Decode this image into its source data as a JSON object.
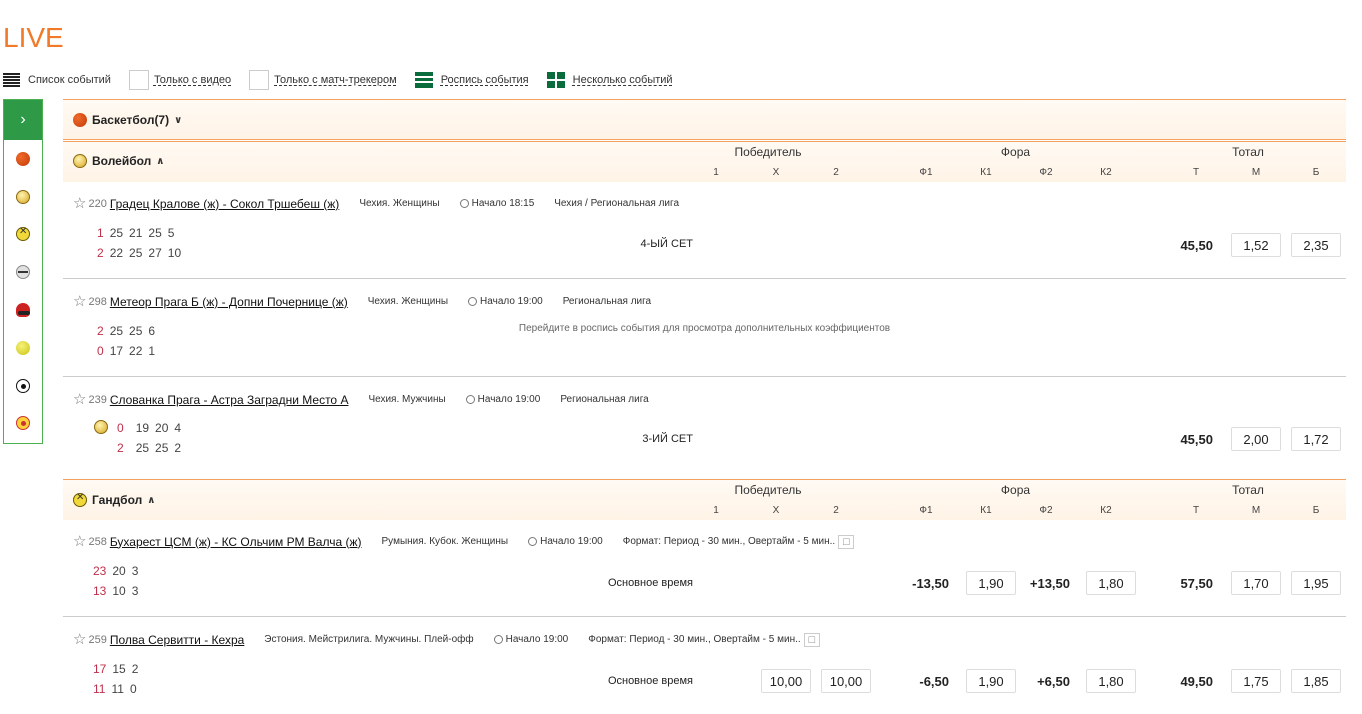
{
  "page_title": "LIVE",
  "viewbar": {
    "event_list": "Список событий",
    "only_video": "Только с видео",
    "only_tracker": "Только с матч-трекером",
    "event_detail": "Роспись события",
    "multi_events": "Несколько событий"
  },
  "sidebar": {
    "toggle_icon": "chevron-right-icon",
    "sports_icons": [
      "basketball-icon",
      "volleyball-icon",
      "handball-icon",
      "hockey-icon",
      "baseball-icon",
      "tennis-icon",
      "football-icon",
      "futsal-icon"
    ]
  },
  "market_headers": {
    "winner": "Победитель",
    "handicap": "Фора",
    "total": "Тотал",
    "c1": "1",
    "cx": "X",
    "c2": "2",
    "f1": "Ф1",
    "k1": "К1",
    "f2": "Ф2",
    "k2": "К2",
    "t": "Т",
    "m": "М",
    "b": "Б"
  },
  "basketball": {
    "name": "Баскетбол(7)"
  },
  "volleyball": {
    "name": "Волейбол",
    "events": [
      {
        "num": "220",
        "match": "Градец Кралове (ж) - Сокол Тршебеш (ж)",
        "country": "Чехия. Женщины",
        "start": "Начало 18:15",
        "league": "Чехия / Региональная лига",
        "top": {
          "sets": "1",
          "games": [
            "25",
            "21",
            "25",
            "5"
          ]
        },
        "bottom": {
          "sets": "2",
          "games": [
            "22",
            "25",
            "27",
            "10"
          ]
        },
        "period": "4-ЫЙ СЕТ",
        "total": "45,50",
        "under": "1,52",
        "over": "2,35"
      },
      {
        "num": "298",
        "match": "Метеор Прага Б (ж) - Допни Почернице (ж)",
        "country": "Чехия. Женщины",
        "start": "Начало 19:00",
        "league": "Региональная лига",
        "top": {
          "sets": "2",
          "games": [
            "25",
            "25",
            "6"
          ]
        },
        "bottom": {
          "sets": "0",
          "games": [
            "17",
            "22",
            "1"
          ]
        },
        "note": "Перейдите в роспись события для просмотра дополнительных коэффициентов"
      },
      {
        "num": "239",
        "match": "Слованка Прага - Астра Заградни Место А",
        "country": "Чехия. Мужчины",
        "start": "Начало 19:00",
        "league": "Региональная лига",
        "top": {
          "sets": "0",
          "games": [
            "19",
            "20",
            "4"
          ]
        },
        "bottom": {
          "sets": "2",
          "games": [
            "25",
            "25",
            "2"
          ]
        },
        "period": "3-ИЙ СЕТ",
        "total": "45,50",
        "under": "2,00",
        "over": "1,72"
      }
    ]
  },
  "handball": {
    "name": "Гандбол",
    "events": [
      {
        "num": "258",
        "match": "Бухарест ЦСМ (ж) - КС Ольчим РМ Валча (ж)",
        "country": "Румыния. Кубок. Женщины",
        "start": "Начало 19:00",
        "league": "Формат: Период - 30 мин., Овертайм - 5 мин..",
        "top": {
          "sets": "23",
          "games": [
            "20",
            "3"
          ]
        },
        "bottom": {
          "sets": "13",
          "games": [
            "10",
            "3"
          ]
        },
        "period": "Основное время",
        "f1": "-13,50",
        "k1": "1,90",
        "f2": "+13,50",
        "k2": "1,80",
        "total": "57,50",
        "under": "1,70",
        "over": "1,95"
      },
      {
        "num": "259",
        "match": "Полва Сервитти - Кехра",
        "country": "Эстония. Мейстрилига. Мужчины. Плей-офф",
        "start": "Начало 19:00",
        "league": "Формат: Период - 30 мин., Овертайм - 5 мин..",
        "top": {
          "sets": "17",
          "games": [
            "15",
            "2"
          ]
        },
        "bottom": {
          "sets": "11",
          "games": [
            "11",
            "0"
          ]
        },
        "period": "Основное время",
        "w1": "10,00",
        "w2": "10,00",
        "f1": "-6,50",
        "k1": "1,90",
        "f2": "+6,50",
        "k2": "1,80",
        "total": "49,50",
        "under": "1,75",
        "over": "1,85"
      }
    ]
  }
}
